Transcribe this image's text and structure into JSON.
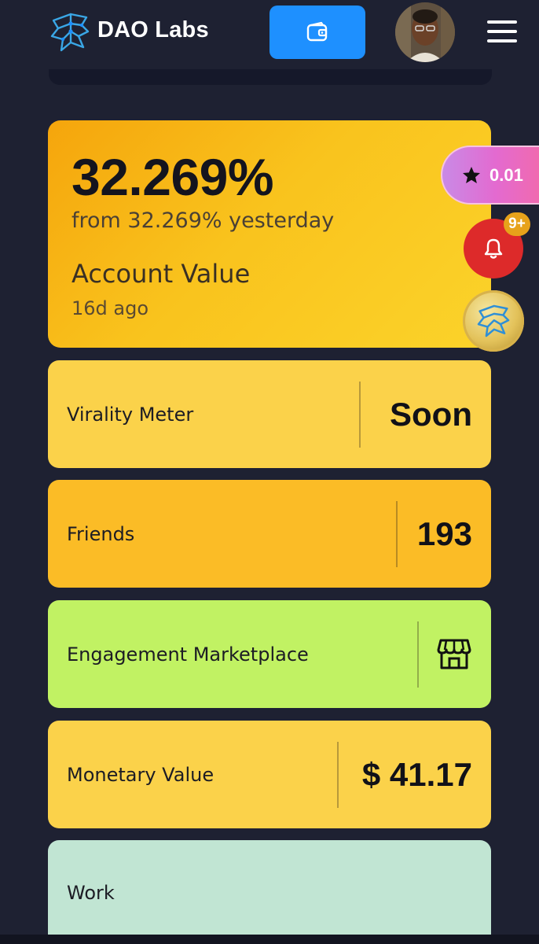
{
  "header": {
    "brand": "DAO Labs",
    "wallet_icon": "wallet-icon",
    "menu_icon": "hamburger-menu-icon"
  },
  "account": {
    "percent": "32.269%",
    "comparison": "from 32.269% yesterday",
    "label": "Account Value",
    "updated": "16d ago"
  },
  "metrics": [
    {
      "label": "Virality Meter",
      "value": "Soon",
      "color": "#fbd24a"
    },
    {
      "label": "Friends",
      "value": "193",
      "color": "#fbbc26"
    },
    {
      "label": "Engagement Marketplace",
      "icon": "store-icon",
      "color": "#c1f263"
    },
    {
      "label": "Monetary Value",
      "value": "$ 41.17",
      "color": "#fbd24a"
    },
    {
      "label": "Work",
      "color": "#c1e5d3"
    }
  ],
  "floating": {
    "points": "0.01",
    "points_icon": "star-icon",
    "notification_badge": "9+",
    "notification_icon": "bell-icon",
    "coin_icon": "dao-coin-icon"
  },
  "colors": {
    "background": "#1e2132",
    "wallet_button": "#1e90ff",
    "bell": "#dd2a2a"
  }
}
